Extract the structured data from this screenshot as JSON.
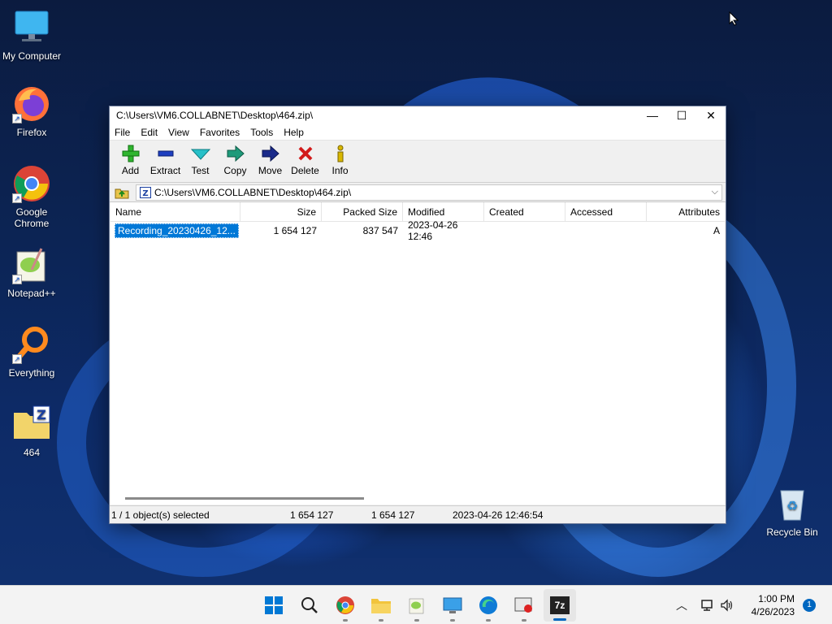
{
  "desktop": {
    "icons": [
      {
        "label": "My Computer"
      },
      {
        "label": "Firefox"
      },
      {
        "label": "Google Chrome"
      },
      {
        "label": "Notepad++"
      },
      {
        "label": "Everything"
      },
      {
        "label": "464"
      },
      {
        "label": "Recycle Bin"
      }
    ]
  },
  "window": {
    "title": "C:\\Users\\VM6.COLLABNET\\Desktop\\464.zip\\",
    "menu": [
      "File",
      "Edit",
      "View",
      "Favorites",
      "Tools",
      "Help"
    ],
    "toolbar": [
      {
        "label": "Add",
        "icon": "add-icon"
      },
      {
        "label": "Extract",
        "icon": "extract-icon"
      },
      {
        "label": "Test",
        "icon": "test-icon"
      },
      {
        "label": "Copy",
        "icon": "copy-icon"
      },
      {
        "label": "Move",
        "icon": "move-icon"
      },
      {
        "label": "Delete",
        "icon": "delete-icon"
      },
      {
        "label": "Info",
        "icon": "info-icon"
      }
    ],
    "address": "C:\\Users\\VM6.COLLABNET\\Desktop\\464.zip\\",
    "columns": [
      "Name",
      "Size",
      "Packed Size",
      "Modified",
      "Created",
      "Accessed",
      "Attributes"
    ],
    "rows": [
      {
        "name": "Recording_20230426_12...",
        "size": "1 654 127",
        "packed": "837 547",
        "modified": "2023-04-26 12:46",
        "created": "",
        "accessed": "",
        "attributes": "A"
      }
    ],
    "status": {
      "selection": "1 / 1 object(s) selected",
      "size": "1 654 127",
      "packed": "1 654 127",
      "modified": "2023-04-26 12:46:54"
    }
  },
  "taskbar": {
    "clock_time": "1:00 PM",
    "clock_date": "4/26/2023",
    "notification_count": "1",
    "active_app_label": "7z"
  },
  "colors": {
    "selection": "#0078d7",
    "accent": "#0067c0"
  }
}
